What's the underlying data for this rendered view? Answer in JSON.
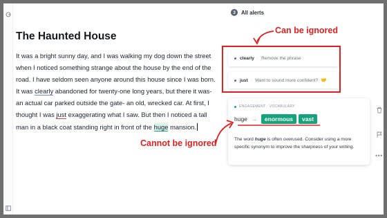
{
  "document": {
    "title": "The Haunted House",
    "body": {
      "p1": "It was a bright sunny day, and I was walking my dog down the street when I noticed something strange about the house by the end of the road. I have seldom seen anyone around this house since I was born. It was ",
      "w_clearly": "clearly",
      "p2": " abandoned for twenty-one long years, but there it was- an actual car parked outside the gate- an old, wrecked car. At first, I thought I was ",
      "w_just": "just",
      "p3": " exaggerating what I saw. But then I noticed a tall man in a black coat standing right in front of the ",
      "w_huge": "huge",
      "p4": " mansion."
    }
  },
  "alerts": {
    "count": "3",
    "title": "All alerts",
    "items": [
      {
        "word": "clearly",
        "separator": "·",
        "description": "Remove the phrase",
        "emoji": ""
      },
      {
        "word": "just",
        "separator": "·",
        "description": "Want to sound more confident?",
        "emoji": "🤝"
      }
    ]
  },
  "card": {
    "category": "ENGAGEMENT · VOCABULARY",
    "original": "huge",
    "arrow": "→",
    "suggestions": [
      "enormous",
      "vast"
    ],
    "desc_a": "The word ",
    "desc_em": "huge",
    "desc_b": " is often overused. Consider using a more specific synonym to improve the sharpness of your writing."
  },
  "annotations": {
    "top_label": "Can be ignored",
    "bottom_label": "Cannot be ignored"
  },
  "colors": {
    "annotation_red": "#e02020",
    "suggestion_green": "#15a37b",
    "underline_blue": "#6a8cd6",
    "underline_red": "#d64646"
  },
  "icons": [
    "grammarly-g-icon",
    "sidebar-bottom-icon",
    "trash-icon",
    "flag-icon",
    "more-icon",
    "arrow-right-icon"
  ]
}
